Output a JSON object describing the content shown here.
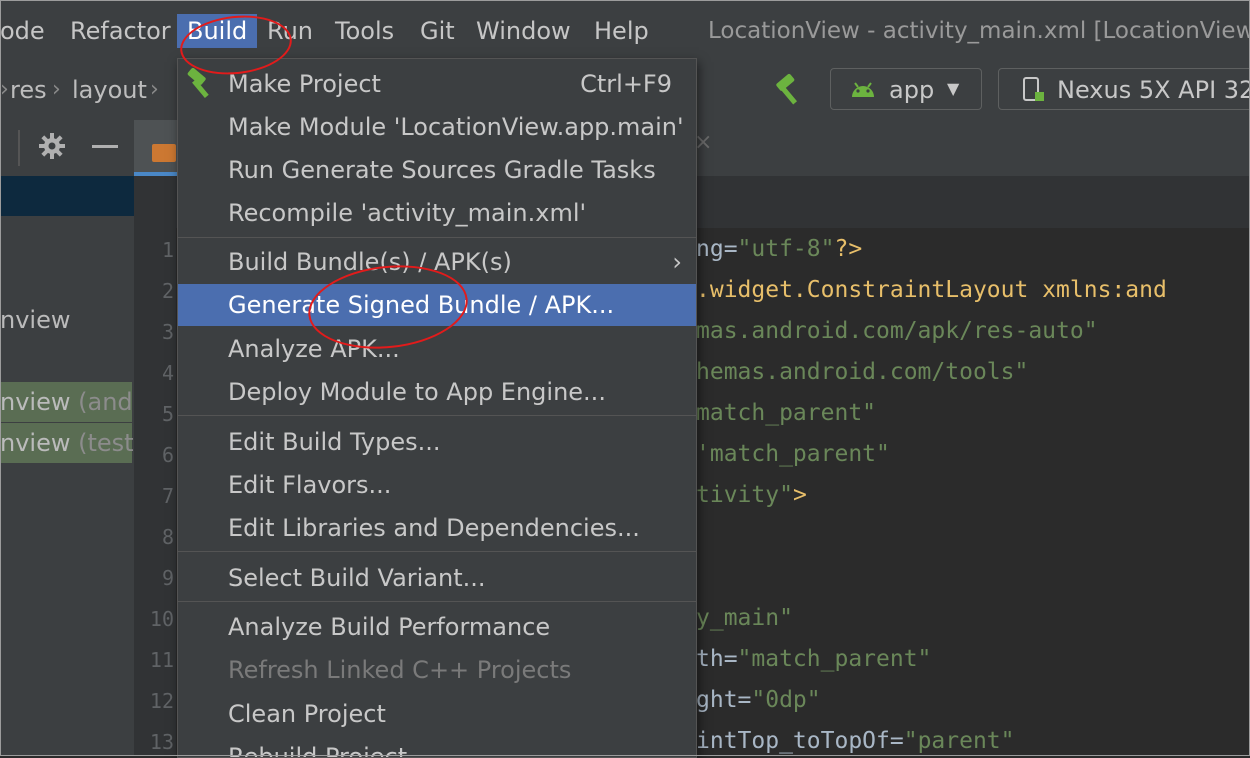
{
  "menubar": {
    "items": [
      "ode",
      "Refactor",
      "Build",
      "Run",
      "Tools",
      "Git",
      "Window",
      "Help"
    ],
    "active": "Build",
    "window_title": "LocationView - activity_main.xml [LocationView."
  },
  "breadcrumb": [
    "res",
    "layout"
  ],
  "toolbar": {
    "run_config": "app",
    "device": "Nexus 5X API 32"
  },
  "project_tree": {
    "items": [
      {
        "label": "nview",
        "suffix": ""
      },
      {
        "label": "nview",
        "suffix": "(andro"
      },
      {
        "label": "nview",
        "suffix": "(test)"
      }
    ]
  },
  "editor": {
    "line_numbers": [
      "1",
      "2",
      "3",
      "4",
      "5",
      "6",
      "7",
      "8",
      "9",
      "10",
      "11",
      "12",
      "13"
    ],
    "lines": [
      {
        "a": "ng=",
        "b": "\"utf-8\"",
        "c": "?>"
      },
      {
        "a": ".widget.ConstraintLayout xmlns:and",
        "b": "",
        "c": ""
      },
      {
        "a": "",
        "b": "mas.android.com/apk/res-auto\"",
        "c": ""
      },
      {
        "a": "",
        "b": "hemas.android.com/tools\"",
        "c": ""
      },
      {
        "a": "",
        "b": "match_parent\"",
        "c": ""
      },
      {
        "a": "",
        "b": "'match_parent\"",
        "c": ""
      },
      {
        "a": "",
        "b": "tivity\"",
        "c": ">"
      },
      {
        "a": "",
        "b": "",
        "c": ""
      },
      {
        "a": "",
        "b": "",
        "c": ""
      },
      {
        "a": "",
        "b": "y_main\"",
        "c": ""
      },
      {
        "a": "th=",
        "b": "\"match_parent\"",
        "c": ""
      },
      {
        "a": "ght=",
        "b": "\"0dp\"",
        "c": ""
      },
      {
        "a": "intTop_toTopOf=",
        "b": "\"parent\"",
        "c": ""
      }
    ]
  },
  "build_menu": {
    "items": [
      {
        "label": "Make Project",
        "shortcut": "Ctrl+F9"
      },
      {
        "label": "Make Module 'LocationView.app.main'"
      },
      {
        "label": "Run Generate Sources Gradle Tasks"
      },
      {
        "label": "Recompile 'activity_main.xml'"
      },
      {
        "label": "Build Bundle(s) / APK(s)"
      },
      {
        "label": "Generate Signed Bundle / APK..."
      },
      {
        "label": "Analyze APK..."
      },
      {
        "label": "Deploy Module to App Engine..."
      },
      {
        "label": "Edit Build Types..."
      },
      {
        "label": "Edit Flavors..."
      },
      {
        "label": "Edit Libraries and Dependencies..."
      },
      {
        "label": "Select Build Variant..."
      },
      {
        "label": "Analyze Build Performance"
      },
      {
        "label": "Refresh Linked C++ Projects"
      },
      {
        "label": "Clean Project"
      },
      {
        "label": "Rebuild Project"
      }
    ],
    "selected_item": "Generate Signed Bundle / APK...",
    "disabled_item": "Refresh Linked C++ Projects"
  },
  "colors": {
    "menu_selection": "#4b6eaf",
    "annotation": "#e21b1b",
    "android_green": "#6cb33f"
  }
}
